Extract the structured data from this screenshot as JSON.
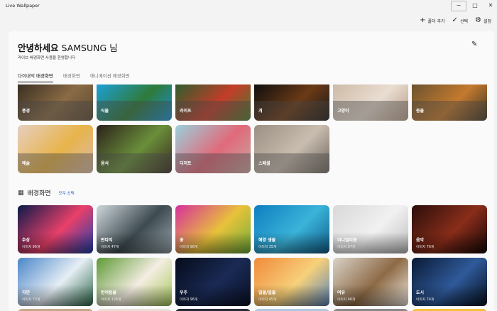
{
  "window": {
    "title": "Live Wallpaper",
    "minimize": "−",
    "maximize": "□",
    "close": "✕"
  },
  "toolbar": {
    "add_folder": {
      "icon": "+",
      "label": "폴더 추가"
    },
    "select": {
      "icon": "✓",
      "label": "선택"
    },
    "settings": {
      "icon": "⚙",
      "label": "설정"
    }
  },
  "header": {
    "greeting": "안녕하세요",
    "user": "SAMSUNG 님",
    "subtitle": "라이브 배경화면 사용을 환영합니다",
    "edit_icon": "✎"
  },
  "tabs": [
    "다이내믹 배경화면",
    "배경화면",
    "애니메이션 배경화면"
  ],
  "dynamic_tiles": [
    {
      "label": "풍경",
      "colors": [
        "#3a2f22",
        "#8a6b45",
        "#5b4a33"
      ]
    },
    {
      "label": "식물",
      "colors": [
        "#1d9fd6",
        "#2f7a3a",
        "#1a8fcf"
      ]
    },
    {
      "label": "라이프",
      "colors": [
        "#2f5d2c",
        "#c33d2a",
        "#4a7a2f"
      ]
    },
    {
      "label": "개",
      "colors": [
        "#0f0f0f",
        "#6b3a16",
        "#1a1a1a"
      ]
    },
    {
      "label": "고양이",
      "colors": [
        "#cdbaa6",
        "#e9ddd2",
        "#b89e86"
      ]
    },
    {
      "label": "동물",
      "colors": [
        "#6b5230",
        "#c47a2e",
        "#3e3424"
      ]
    },
    {
      "label": "예술",
      "colors": [
        "#e6cfc2",
        "#e8b44a",
        "#d9b9a9"
      ]
    },
    {
      "label": "음식",
      "colors": [
        "#2b211b",
        "#6a8f3a",
        "#3a2a22"
      ]
    },
    {
      "label": "디저트",
      "colors": [
        "#9bd0dc",
        "#e06a7a",
        "#c9a6a0"
      ]
    },
    {
      "label": "스페셜",
      "colors": [
        "#9a8f82",
        "#c9bdb0",
        "#6e655c"
      ]
    }
  ],
  "wallpaper_section": {
    "icon": "▦",
    "title": "배경화면",
    "select_all": "모두 선택"
  },
  "wallpaper_tiles": [
    {
      "title": "추상",
      "count": "이미지 96개",
      "colors": [
        "#0c1a4a",
        "#e9406a",
        "#1f3fb0"
      ]
    },
    {
      "title": "판타지",
      "count": "이미지 47개",
      "colors": [
        "#cfd7dc",
        "#3d4a50",
        "#9aa7ad"
      ]
    },
    {
      "title": "꽃",
      "count": "이미지 96개",
      "colors": [
        "#d6309c",
        "#e8c23a",
        "#6fae3a"
      ]
    },
    {
      "title": "해양 생물",
      "count": "이미지 35개",
      "colors": [
        "#0e7ec0",
        "#3ab3d9",
        "#115f8a"
      ]
    },
    {
      "title": "미니멀리즘",
      "count": "이미지 87개",
      "colors": [
        "#d8d8d8",
        "#f1f1f1",
        "#bfbfbf"
      ]
    },
    {
      "title": "음악",
      "count": "이미지 76개",
      "colors": [
        "#2a0e0a",
        "#8a2d1a",
        "#160707"
      ]
    },
    {
      "title": "자연",
      "count": "이미지 73개",
      "colors": [
        "#4a86c9",
        "#e6eef5",
        "#2f6a4a"
      ]
    },
    {
      "title": "반려동물",
      "count": "이미지 126개",
      "colors": [
        "#5d9a36",
        "#f4ede2",
        "#a8c95a"
      ]
    },
    {
      "title": "우주",
      "count": "이미지 96개",
      "colors": [
        "#060b1a",
        "#1a2a55",
        "#0a1024"
      ]
    },
    {
      "title": "일몰/일출",
      "count": "이미지 45개",
      "colors": [
        "#f08a3a",
        "#f7d07a",
        "#5a86b8"
      ]
    },
    {
      "title": "여유",
      "count": "이미지 66개",
      "colors": [
        "#d9d2c7",
        "#8d6a45",
        "#efe9e0"
      ]
    },
    {
      "title": "도시",
      "count": "이미지 74개",
      "colors": [
        "#0a1a35",
        "#2f5a9a",
        "#06101f"
      ]
    }
  ],
  "partial_colors": [
    "#c7a98a",
    "#e8e0d6",
    "#2a2a3a",
    "#b0c9e0",
    "#8a8a8a",
    "#f5c23a"
  ]
}
